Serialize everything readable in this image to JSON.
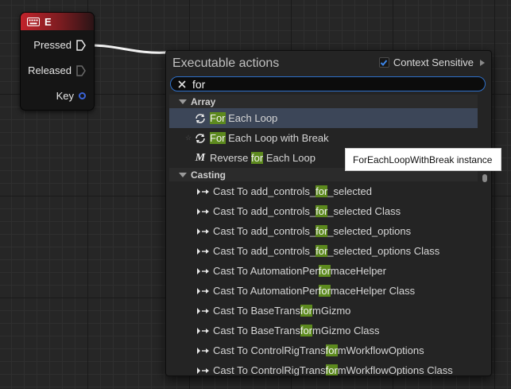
{
  "node": {
    "title": "E",
    "pins": [
      "Pressed",
      "Released",
      "Key"
    ]
  },
  "popup": {
    "title": "Executable actions",
    "context_label": "Context Sensitive",
    "context_checked": true,
    "search": {
      "value": "for",
      "placeholder": ""
    }
  },
  "categories": {
    "array": "Array",
    "casting": "Casting"
  },
  "items": [
    {
      "pre": "",
      "hl": "For",
      "post": " Each Loop",
      "icon": "loop-icon"
    },
    {
      "pre": "",
      "hl": "For",
      "post": " Each Loop with Break",
      "icon": "loop-icon"
    },
    {
      "pre": "Reverse ",
      "hl": "for",
      "post": " Each Loop",
      "icon": "macro-icon"
    },
    {
      "pre": "Cast To add_controls_",
      "hl": "for",
      "post": "_selected",
      "icon": "cast-icon"
    },
    {
      "pre": "Cast To add_controls_",
      "hl": "for",
      "post": "_selected Class",
      "icon": "cast-icon"
    },
    {
      "pre": "Cast To add_controls_",
      "hl": "for",
      "post": "_selected_options",
      "icon": "cast-icon"
    },
    {
      "pre": "Cast To add_controls_",
      "hl": "for",
      "post": "_selected_options Class",
      "icon": "cast-icon"
    },
    {
      "pre": "Cast To AutomationPer",
      "hl": "for",
      "post": "maceHelper",
      "icon": "cast-icon"
    },
    {
      "pre": "Cast To AutomationPer",
      "hl": "for",
      "post": "maceHelper Class",
      "icon": "cast-icon"
    },
    {
      "pre": "Cast To BaseTrans",
      "hl": "for",
      "post": "mGizmo",
      "icon": "cast-icon"
    },
    {
      "pre": "Cast To BaseTrans",
      "hl": "for",
      "post": "mGizmo Class",
      "icon": "cast-icon"
    },
    {
      "pre": "Cast To ControlRigTrans",
      "hl": "for",
      "post": "mWorkflowOptions",
      "icon": "cast-icon"
    },
    {
      "pre": "Cast To ControlRigTrans",
      "hl": "for",
      "post": "mWorkflowOptions Class",
      "icon": "cast-icon"
    }
  ],
  "tooltip": "ForEachLoopWithBreak instance",
  "colors": {
    "highlight": "#5d8a1e",
    "selected_row": "#3c4658",
    "search_border": "#2e70c9",
    "node_header": "#c2232b"
  }
}
